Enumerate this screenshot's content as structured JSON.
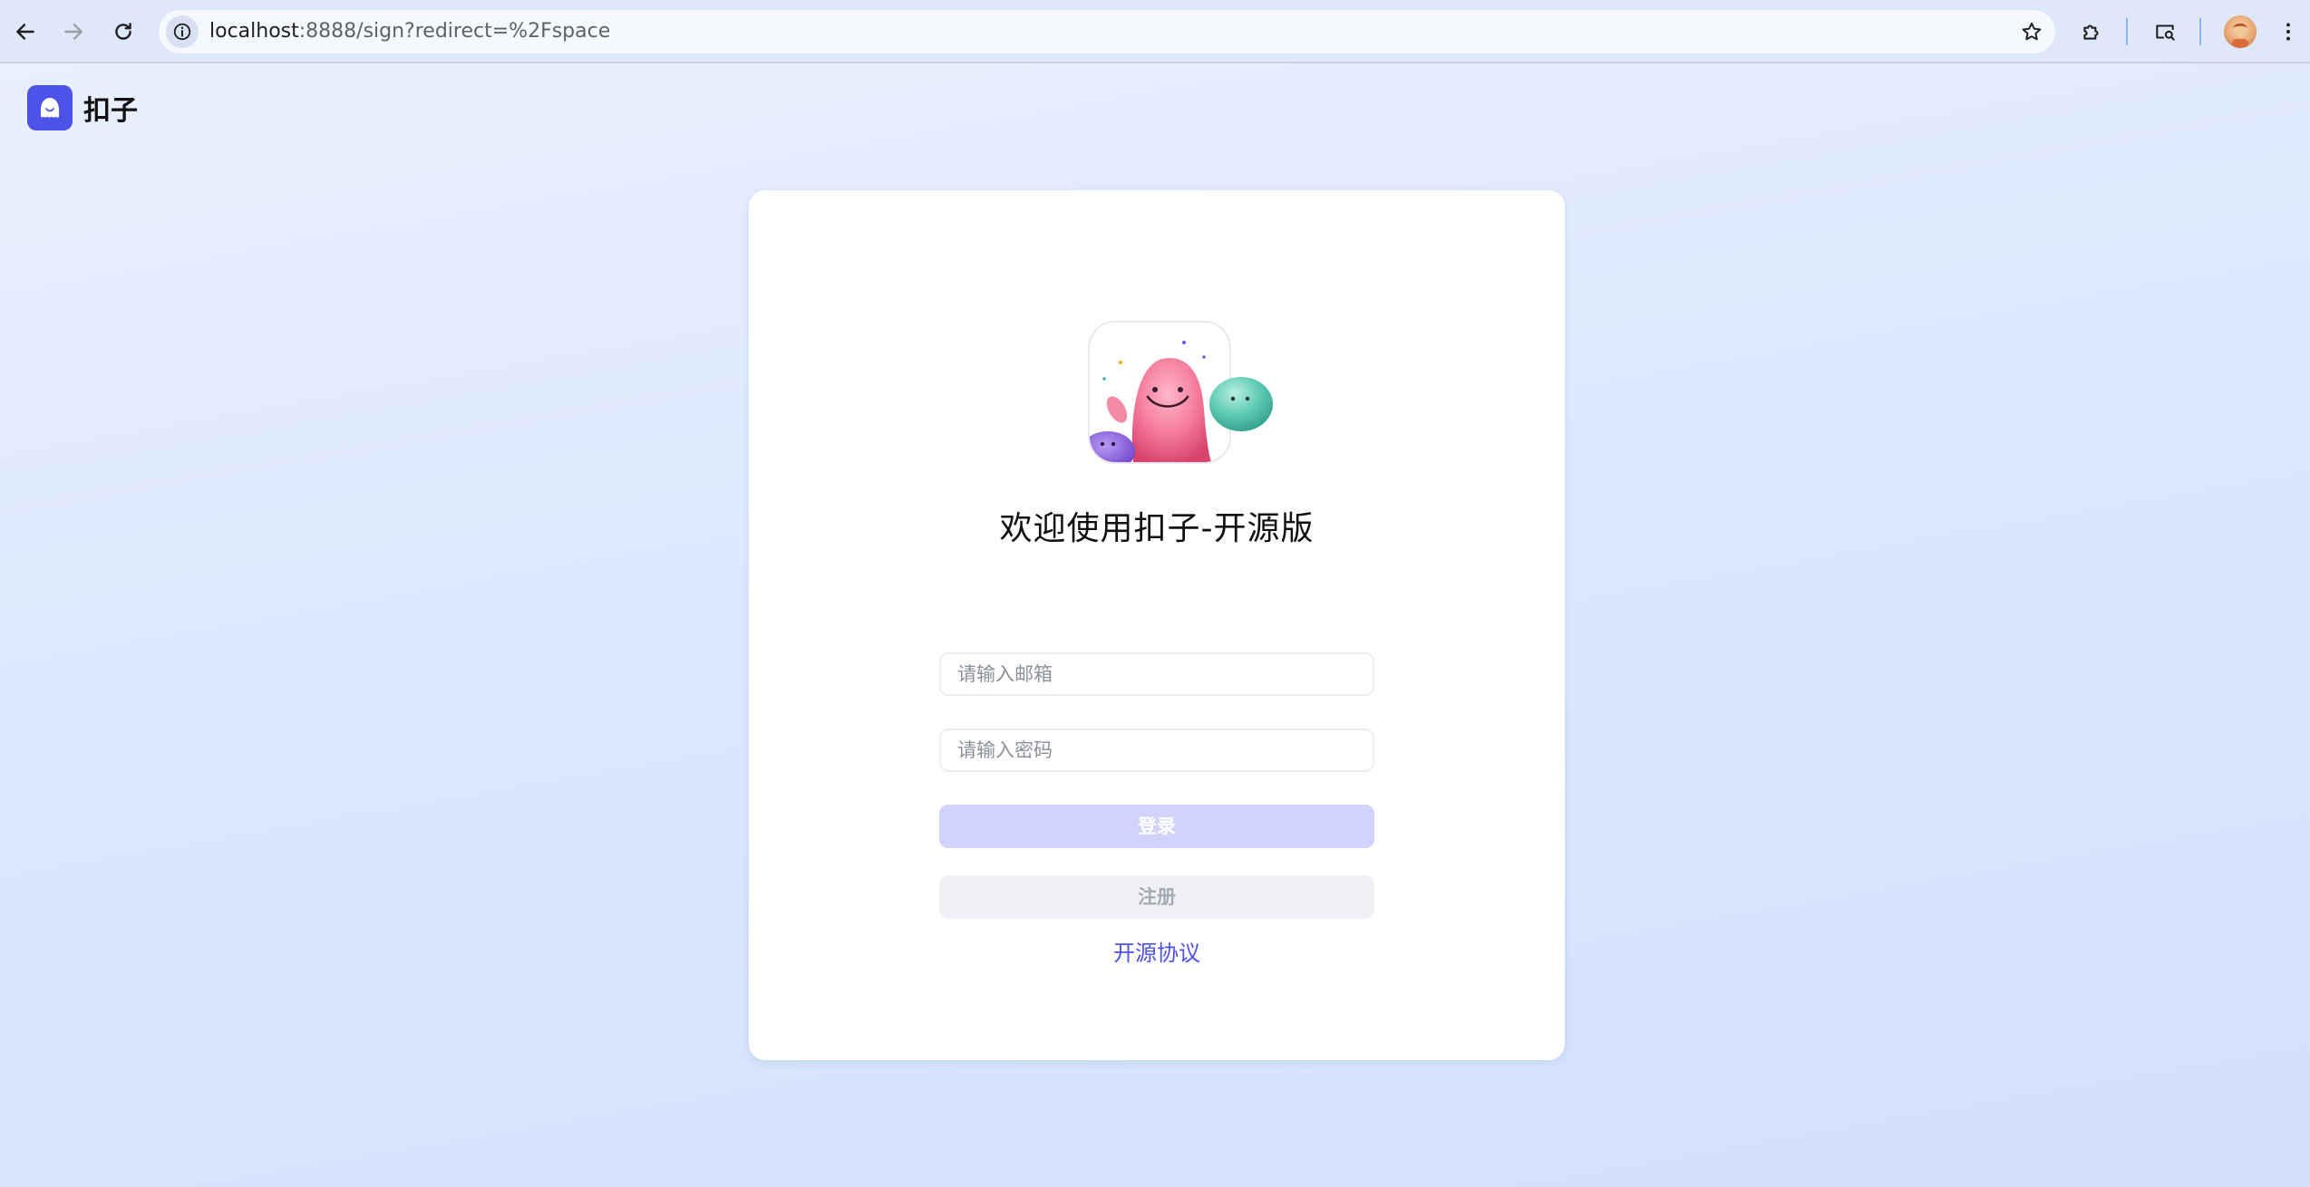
{
  "browser": {
    "url_host": "localhost",
    "url_rest": ":8888/sign?redirect=%2Fspace"
  },
  "header": {
    "brand_name": "扣子"
  },
  "login": {
    "title": "欢迎使用扣子-开源版",
    "email_placeholder": "请输入邮箱",
    "password_placeholder": "请输入密码",
    "login_label": "登录",
    "register_label": "注册",
    "license_link": "开源协议"
  },
  "colors": {
    "brand": "#4d53e8",
    "login_button_disabled": "#d2d3fb",
    "register_button": "#f0f1f5"
  },
  "icons": {
    "back": "arrow-left-icon",
    "forward": "arrow-right-icon",
    "reload": "reload-icon",
    "site_info": "info-icon",
    "bookmark": "star-icon",
    "extensions": "puzzle-icon",
    "cast": "search-tab-icon",
    "menu": "kebab-menu-icon"
  }
}
